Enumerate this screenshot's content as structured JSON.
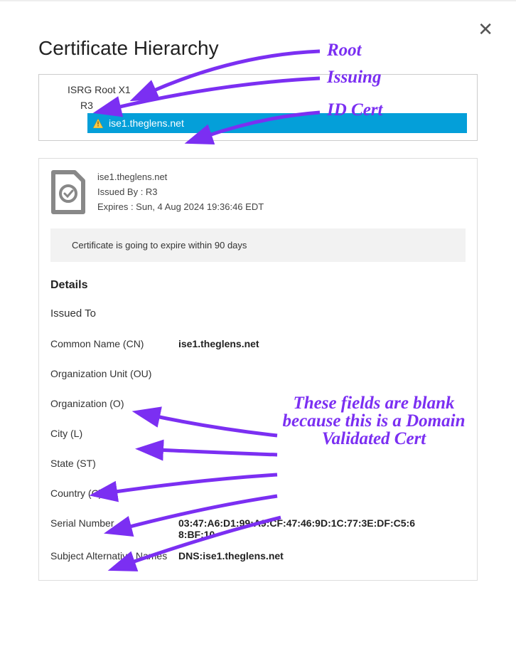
{
  "title": "Certificate Hierarchy",
  "close_glyph": "✕",
  "hierarchy": {
    "root": "ISRG Root X1",
    "intermediate": "R3",
    "leaf": "ise1.theglens.net"
  },
  "cert": {
    "subject": "ise1.theglens.net",
    "issued_by": "Issued By : R3",
    "expires": "Expires : Sun, 4 Aug 2024 19:36:46 EDT",
    "expire_banner": "Certificate is going to expire within 90 days"
  },
  "details_heading": "Details",
  "issued_to_heading": "Issued To",
  "fields": {
    "cn_label": "Common Name (CN)",
    "cn_value": "ise1.theglens.net",
    "ou_label": "Organization Unit (OU)",
    "ou_value": "",
    "o_label": "Organization (O)",
    "o_value": "",
    "l_label": "City (L)",
    "l_value": "",
    "st_label": "State (ST)",
    "st_value": "",
    "c_label": "Country (C)",
    "c_value": "",
    "serial_label": "Serial Number",
    "serial_value": "03:47:A6:D1:99:A9:CF:47:46:9D:1C:77:3E:DF:C5:68:BF:10",
    "san_label": "Subject Alternative Names",
    "san_value": "DNS:ise1.theglens.net"
  },
  "annotations": {
    "root": "Root",
    "issuing": "Issuing",
    "idcert": "ID Cert",
    "blank_text": "These fields are blank because this is a Domain Validated Cert"
  }
}
